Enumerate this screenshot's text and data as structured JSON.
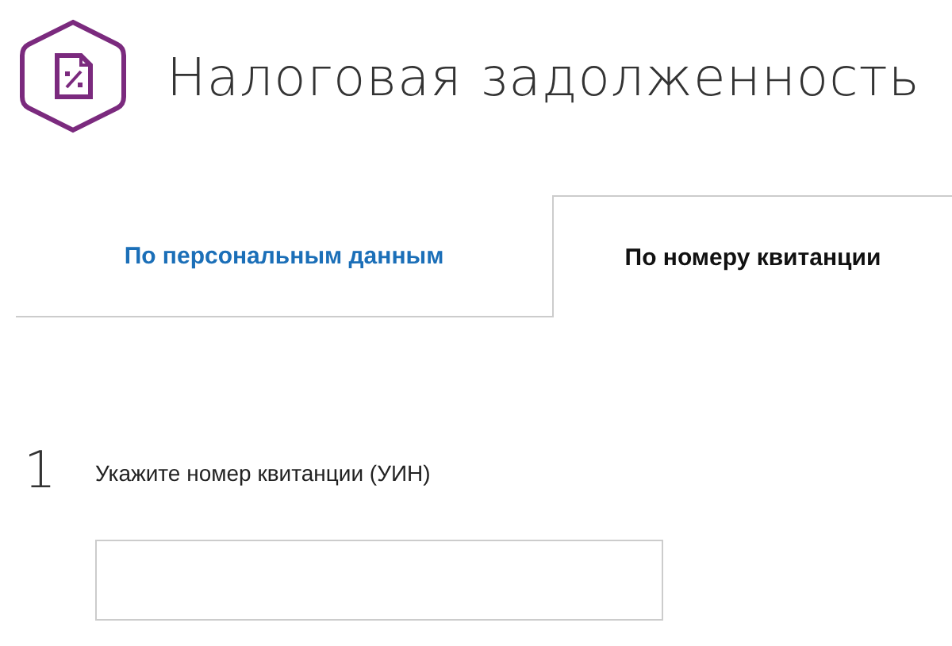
{
  "header": {
    "title": "Налоговая задолженность"
  },
  "tabs": [
    {
      "label": "По персональным данным",
      "selected": false
    },
    {
      "label": "По номеру квитанции",
      "selected": true
    }
  ],
  "step": {
    "number": "1",
    "label": "Укажите номер квитанции (УИН)"
  }
}
